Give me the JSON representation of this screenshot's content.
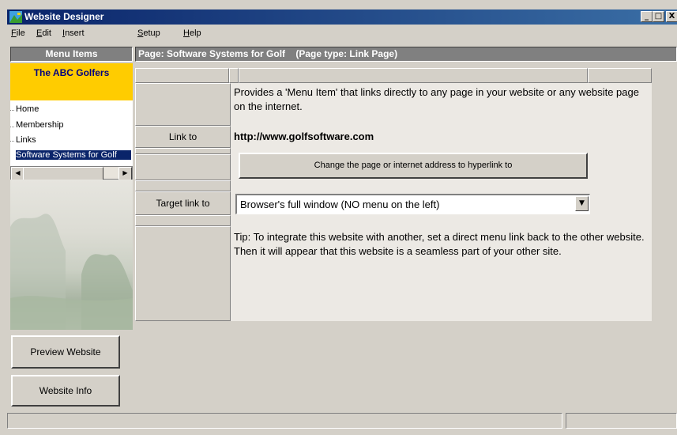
{
  "window": {
    "title": "Website Designer",
    "icon": "app-icon",
    "controls": [
      "_",
      "□",
      "X"
    ]
  },
  "menu": [
    {
      "label": "File",
      "mnemonic": "F"
    },
    {
      "label": "Edit",
      "mnemonic": "E"
    },
    {
      "label": "Insert",
      "mnemonic": "I"
    },
    {
      "label": "Setup",
      "mnemonic": "S"
    },
    {
      "label": "Help",
      "mnemonic": "H"
    }
  ],
  "left_panel": {
    "header": "Menu Items",
    "site_title": "The ABC Golfers",
    "items": [
      "Home",
      "Membership",
      "Links",
      "Software Systems for Golf"
    ],
    "selected_index": 3,
    "preview_button": "Preview Website",
    "info_button": "Website Info"
  },
  "page_header": "Page: Software Systems for Golf    (Page type: Link Page)",
  "main": {
    "description": "Provides a 'Menu Item' that links directly to any page in your website or any website page on the internet.",
    "link_label": "Link to",
    "link_url": "http://www.golfsoftware.com",
    "change_button": "Change the page or internet address to hyperlink to",
    "target_label": "Target link to",
    "target_value": "Browser's full window (NO menu on the left)",
    "tip": "Tip: To integrate this website with another, set a direct menu link back to the other website. Then it will appear that this website is a seamless part of your other site."
  },
  "colors": {
    "titlebar": "#0a246a",
    "site_title_bg": "#ffcc00",
    "selection": "#0a246a",
    "header_bg": "#808080"
  }
}
